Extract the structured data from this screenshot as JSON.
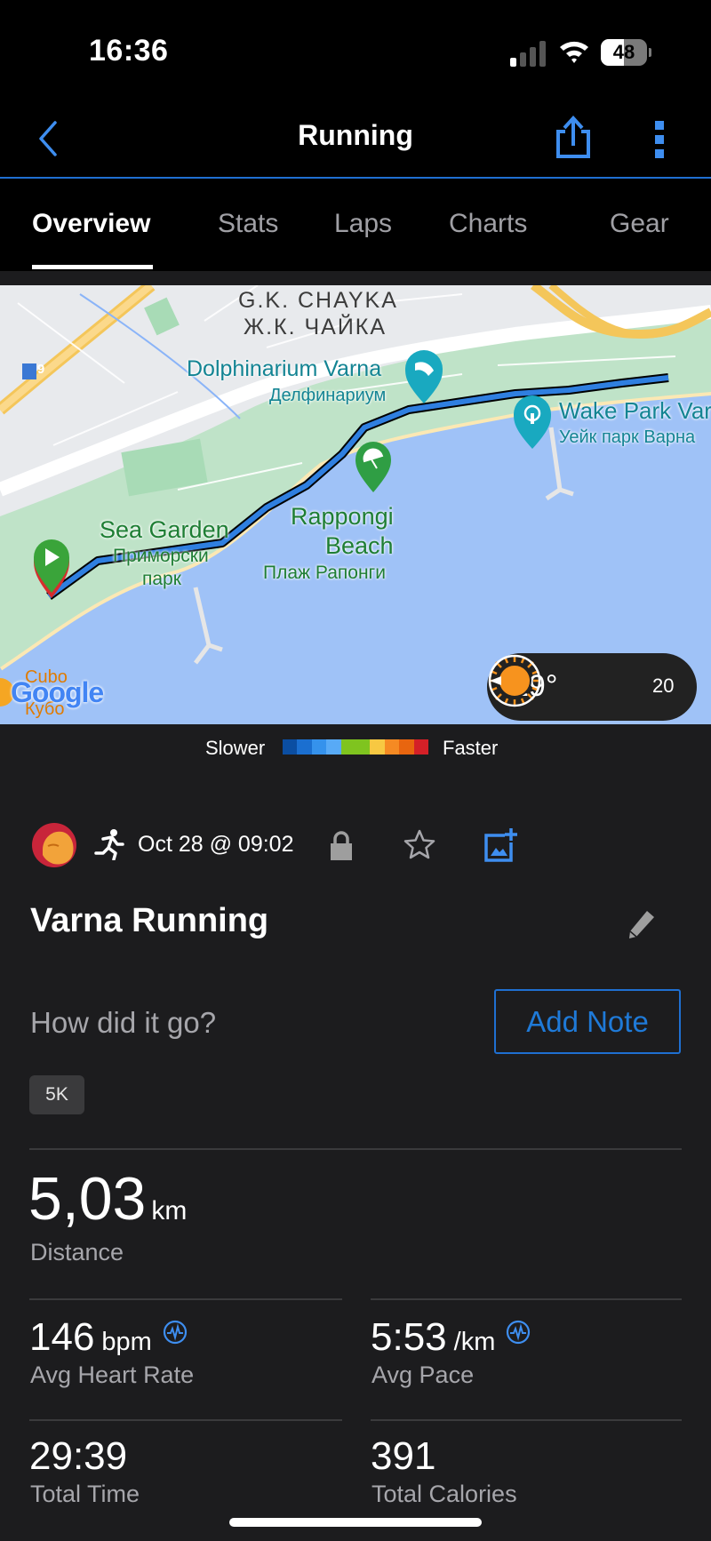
{
  "status_bar": {
    "time": "16:36",
    "battery": "48",
    "signal_icon": "cellular-signal-icon",
    "wifi_icon": "wifi-icon"
  },
  "nav": {
    "title": "Running",
    "back_icon": "chevron-left-icon",
    "share_icon": "share-icon",
    "more_icon": "more-vertical-icon",
    "accent_color": "#1f6fd1"
  },
  "tabs": [
    {
      "label": "Overview",
      "active": true
    },
    {
      "label": "Stats",
      "active": false
    },
    {
      "label": "Laps",
      "active": false
    },
    {
      "label": "Charts",
      "active": false
    },
    {
      "label": "Gear",
      "active": false
    }
  ],
  "map": {
    "labels": {
      "district_en": "G.K. CHAYKA",
      "district_bg": "Ж.К. ЧАЙКА",
      "dolphinarium_en": "Dolphinarium Varna",
      "dolphinarium_bg": "Делфинариум",
      "wakepark_en": "Wake Park Varna",
      "wakepark_bg": "Уейк парк Варна",
      "seagarden_en": "Sea Garden",
      "seagarden_bg_1": "Приморски",
      "seagarden_bg_2": "парк",
      "beach_en_1": "Rappongi",
      "beach_en_2": "Beach",
      "beach_bg": "Плаж Рапонги",
      "cubo_en": "Cubo",
      "cubo_bg": "Кубо",
      "road_number": "9",
      "attribution": "Google"
    },
    "weather": {
      "temperature": "19°",
      "condition_icon": "sun-icon",
      "wind_speed": "20",
      "wind_icon": "wind-direction-icon"
    }
  },
  "legend": {
    "slower": "Slower",
    "faster": "Faster",
    "colors": [
      "#0b4ea2",
      "#1b6fd0",
      "#3592ec",
      "#58aaf6",
      "#7fc41f",
      "#7fc41f",
      "#f7c842",
      "#f58a23",
      "#e8650f",
      "#d42027"
    ]
  },
  "activity": {
    "date": "Oct 28 @ 09:02",
    "type_icon": "running-icon",
    "privacy_icon": "lock-icon",
    "favorite_icon": "star-icon",
    "photo_icon": "add-photo-icon",
    "title": "Varna Running",
    "edit_icon": "pencil-icon",
    "note_prompt": "How did it go?",
    "add_note_label": "Add Note",
    "tag": "5K"
  },
  "stats": {
    "distance": {
      "value": "5,03",
      "unit": "km",
      "label": "Distance"
    },
    "avg_hr": {
      "value": "146",
      "unit": "bpm",
      "label": "Avg Heart Rate"
    },
    "avg_pace": {
      "value": "5:53",
      "unit": "/km",
      "label": "Avg Pace"
    },
    "total_time": {
      "value": "29:39",
      "label": "Total Time"
    },
    "calories": {
      "value": "391",
      "label": "Total Calories"
    }
  }
}
